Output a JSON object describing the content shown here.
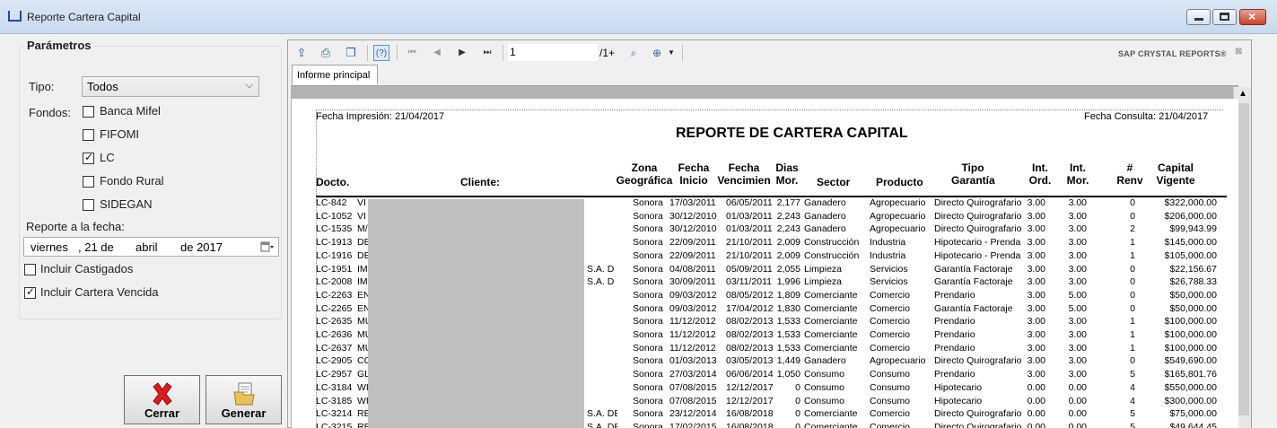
{
  "window": {
    "title": "Reporte Cartera Capital"
  },
  "params": {
    "legend": "Parámetros",
    "tipo_label": "Tipo:",
    "tipo_value": "Todos",
    "fondos_label": "Fondos:",
    "fondos": [
      {
        "label": "Banca Mifel",
        "checked": false
      },
      {
        "label": "FIFOMI",
        "checked": false
      },
      {
        "label": "LC",
        "checked": true
      },
      {
        "label": "Fondo Rural",
        "checked": false
      },
      {
        "label": "SIDEGAN",
        "checked": false
      }
    ],
    "fecha_label": "Reporte a la fecha:",
    "fecha": {
      "dia": "viernes",
      "num": ", 21 de",
      "mes": "abril",
      "anio": "de 2017"
    },
    "castigados_label": "Incluir Castigados",
    "castigados_checked": false,
    "vencida_label": "Incluir Cartera Vencida",
    "vencida_checked": true
  },
  "buttons": {
    "cerrar": "Cerrar",
    "generar": "Generar"
  },
  "viewer": {
    "page": "1",
    "page_total": "/1+",
    "brand": "SAP CRYSTAL REPORTS®",
    "tab": "Informe principal"
  },
  "report": {
    "fecha_impresion": "Fecha Impresión: 21/04/2017",
    "fecha_consulta": "Fecha Consulta: 21/04/2017",
    "title": "REPORTE DE CARTERA CAPITAL",
    "headers": {
      "docto": "Docto.",
      "cliente": "Cliente:",
      "zona": "Zona Geográfica",
      "fecha_inicio": "Fecha Inicio",
      "fecha_venc": "Fecha Vencimien",
      "dias": "Dias Mor.",
      "sector": "Sector",
      "producto": "Producto",
      "tipo_garantia": "Tipo Garantía",
      "int_ord": "Int. Ord.",
      "int_mor": "Int. Mor.",
      "renv": "# Renv",
      "capital": "Capital Vigente"
    },
    "rows": [
      {
        "docto": "LC-842",
        "cli": "VI",
        "sa": "",
        "zona": "Sonora",
        "ini": "17/03/2011",
        "venc": "06/05/2011",
        "dias": "2,177",
        "sector": "Ganadero",
        "prod": "Agropecuario",
        "gar": "Directo Quirografario",
        "io": "3.00",
        "im": "3.00",
        "renv": "0",
        "cap": "$322,000.00"
      },
      {
        "docto": "LC-1052",
        "cli": "VI",
        "sa": "",
        "zona": "Sonora",
        "ini": "30/12/2010",
        "venc": "01/03/2011",
        "dias": "2,243",
        "sector": "Ganadero",
        "prod": "Agropecuario",
        "gar": "Directo Quirografario",
        "io": "3.00",
        "im": "3.00",
        "renv": "0",
        "cap": "$206,000.00"
      },
      {
        "docto": "LC-1535",
        "cli": "M/",
        "sa": "",
        "zona": "Sonora",
        "ini": "30/12/2010",
        "venc": "01/03/2011",
        "dias": "2,243",
        "sector": "Ganadero",
        "prod": "Agropecuario",
        "gar": "Directo Quirografario",
        "io": "3.00",
        "im": "3.00",
        "renv": "2",
        "cap": "$99,943.99"
      },
      {
        "docto": "LC-1913",
        "cli": "DE",
        "sa": "",
        "zona": "Sonora",
        "ini": "22/09/2011",
        "venc": "21/10/2011",
        "dias": "2,009",
        "sector": "Construcción",
        "prod": "Industria",
        "gar": "Hipotecario - Prenda",
        "io": "3.00",
        "im": "3.00",
        "renv": "1",
        "cap": "$145,000.00"
      },
      {
        "docto": "LC-1916",
        "cli": "DE",
        "sa": "",
        "zona": "Sonora",
        "ini": "22/09/2011",
        "venc": "21/10/2011",
        "dias": "2,009",
        "sector": "Construcción",
        "prod": "Industria",
        "gar": "Hipotecario - Prenda",
        "io": "3.00",
        "im": "3.00",
        "renv": "1",
        "cap": "$105,000.00"
      },
      {
        "docto": "LC-1951",
        "cli": "IMI",
        "sa": "S.A. D",
        "zona": "Sonora",
        "ini": "04/08/2011",
        "venc": "05/09/2011",
        "dias": "2,055",
        "sector": "Limpieza",
        "prod": "Servicios",
        "gar": "Garantía Factoraje",
        "io": "3.00",
        "im": "3.00",
        "renv": "0",
        "cap": "$22,156.67"
      },
      {
        "docto": "LC-2008",
        "cli": "IMI",
        "sa": "S.A. D",
        "zona": "Sonora",
        "ini": "30/09/2011",
        "venc": "03/11/2011",
        "dias": "1,996",
        "sector": "Limpieza",
        "prod": "Servicios",
        "gar": "Garantía Factoraje",
        "io": "3.00",
        "im": "3.00",
        "renv": "0",
        "cap": "$26,788.33"
      },
      {
        "docto": "LC-2263",
        "cli": "EN",
        "sa": "",
        "zona": "Sonora",
        "ini": "09/03/2012",
        "venc": "08/05/2012",
        "dias": "1,809",
        "sector": "Comerciante",
        "prod": "Comercio",
        "gar": "Prendario",
        "io": "3.00",
        "im": "5.00",
        "renv": "0",
        "cap": "$50,000.00"
      },
      {
        "docto": "LC-2265",
        "cli": "EN",
        "sa": "",
        "zona": "Sonora",
        "ini": "09/03/2012",
        "venc": "17/04/2012",
        "dias": "1,830",
        "sector": "Comerciante",
        "prod": "Comercio",
        "gar": "Garantía Factoraje",
        "io": "3.00",
        "im": "5.00",
        "renv": "0",
        "cap": "$50,000.00"
      },
      {
        "docto": "LC-2635",
        "cli": "MU",
        "sa": "",
        "zona": "Sonora",
        "ini": "11/12/2012",
        "venc": "08/02/2013",
        "dias": "1,533",
        "sector": "Comerciante",
        "prod": "Comercio",
        "gar": "Prendario",
        "io": "3.00",
        "im": "3.00",
        "renv": "1",
        "cap": "$100,000.00"
      },
      {
        "docto": "LC-2636",
        "cli": "MU",
        "sa": "",
        "zona": "Sonora",
        "ini": "11/12/2012",
        "venc": "08/02/2013",
        "dias": "1,533",
        "sector": "Comerciante",
        "prod": "Comercio",
        "gar": "Prendario",
        "io": "3.00",
        "im": "3.00",
        "renv": "1",
        "cap": "$100,000.00"
      },
      {
        "docto": "LC-2637",
        "cli": "MU",
        "sa": "",
        "zona": "Sonora",
        "ini": "11/12/2012",
        "venc": "08/02/2013",
        "dias": "1,533",
        "sector": "Comerciante",
        "prod": "Comercio",
        "gar": "Prendario",
        "io": "3.00",
        "im": "3.00",
        "renv": "1",
        "cap": "$100,000.00"
      },
      {
        "docto": "LC-2905",
        "cli": "CO",
        "sa": "",
        "zona": "Sonora",
        "ini": "01/03/2013",
        "venc": "03/05/2013",
        "dias": "1,449",
        "sector": "Ganadero",
        "prod": "Agropecuario",
        "gar": "Directo Quirografario",
        "io": "3.00",
        "im": "3.00",
        "renv": "0",
        "cap": "$549,690.00"
      },
      {
        "docto": "LC-2957",
        "cli": "GL",
        "sa": "",
        "zona": "Sonora",
        "ini": "27/03/2014",
        "venc": "06/06/2014",
        "dias": "1,050",
        "sector": "Consumo",
        "prod": "Consumo",
        "gar": "Prendario",
        "io": "3.00",
        "im": "3.00",
        "renv": "5",
        "cap": "$165,801.76"
      },
      {
        "docto": "LC-3184",
        "cli": "WI",
        "sa": "",
        "zona": "Sonora",
        "ini": "07/08/2015",
        "venc": "12/12/2017",
        "dias": "0",
        "sector": "Consumo",
        "prod": "Consumo",
        "gar": "Hipotecario",
        "io": "0.00",
        "im": "0.00",
        "renv": "4",
        "cap": "$550,000.00"
      },
      {
        "docto": "LC-3185",
        "cli": "WI",
        "sa": "",
        "zona": "Sonora",
        "ini": "07/08/2015",
        "venc": "12/12/2017",
        "dias": "0",
        "sector": "Consumo",
        "prod": "Consumo",
        "gar": "Hipotecario",
        "io": "0.00",
        "im": "0.00",
        "renv": "4",
        "cap": "$300,000.00"
      },
      {
        "docto": "LC-3214",
        "cli": "RE",
        "sa": "S.A. DE",
        "zona": "Sonora",
        "ini": "23/12/2014",
        "venc": "16/08/2018",
        "dias": "0",
        "sector": "Comerciante",
        "prod": "Comercio",
        "gar": "Directo Quirografario",
        "io": "0.00",
        "im": "0.00",
        "renv": "5",
        "cap": "$75,000.00"
      },
      {
        "docto": "LC-3215",
        "cli": "RE",
        "sa": "S.A. DE",
        "zona": "Sonora",
        "ini": "17/02/2015",
        "venc": "16/08/2018",
        "dias": "0",
        "sector": "Comerciante",
        "prod": "Comercio",
        "gar": "Directo Quirografario",
        "io": "0.00",
        "im": "0.00",
        "renv": "5",
        "cap": "$49,644.45"
      }
    ]
  }
}
